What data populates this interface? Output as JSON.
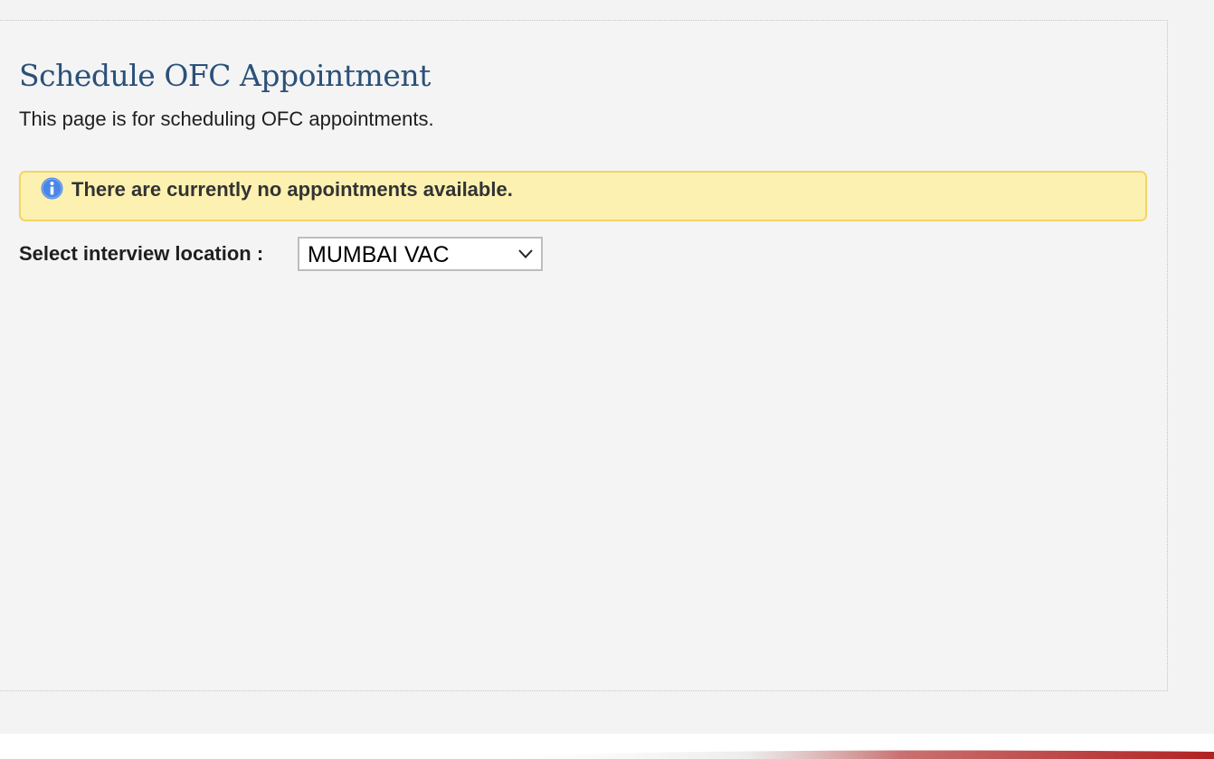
{
  "page": {
    "title": "Schedule OFC Appointment",
    "description": "This page is for scheduling OFC appointments."
  },
  "notice": {
    "icon": "info-icon",
    "text": "There are currently no appointments available.",
    "background": "#fdf1b1",
    "border": "#f2d565"
  },
  "location": {
    "label": "Select interview location :",
    "selected": "MUMBAI VAC",
    "icon": "chevron-down-icon"
  },
  "colors": {
    "title": "#2b5178",
    "info_icon": "#4a86e8",
    "footer_accent": "#b22222"
  }
}
